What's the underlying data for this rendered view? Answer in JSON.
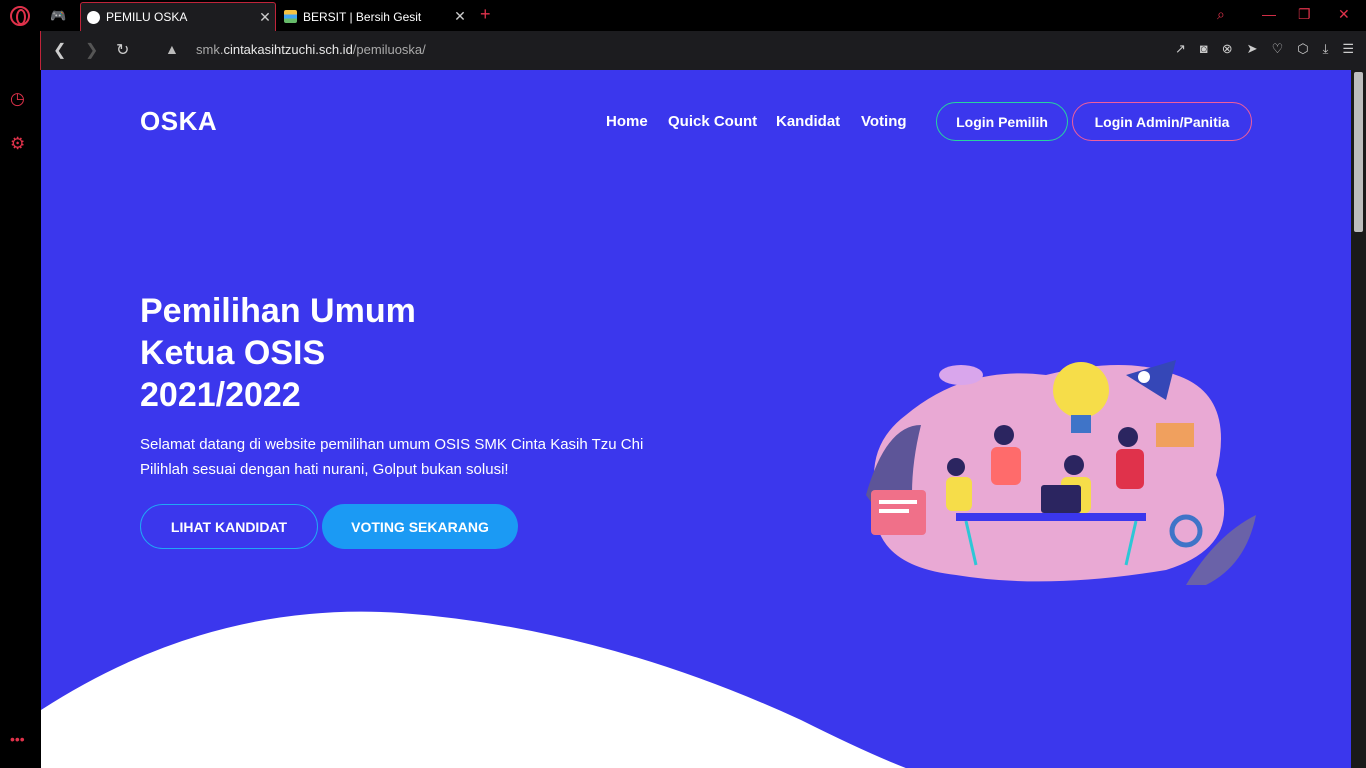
{
  "browser": {
    "tabs": [
      {
        "title": "PEMILU OSKA",
        "active": true
      },
      {
        "title": "BERSIT | Bersih Gesit",
        "active": false
      }
    ],
    "url_prefix": "smk.",
    "url_domain": "cintakasihtzuchi.sch.id",
    "url_path": "/pemiluoska/",
    "accent_color": "#e0324b"
  },
  "site": {
    "logo": "OSKA",
    "nav": [
      "Home",
      "Quick Count",
      "Kandidat",
      "Voting"
    ],
    "login_pemilih": "Login Pemilih",
    "login_admin": "Login Admin/Panitia",
    "hero": {
      "line1": "Pemilihan Umum",
      "line2": "Ketua OSIS",
      "line3": "2021/2022",
      "subtitle1": "Selamat datang di website pemilihan umum OSIS SMK Cinta Kasih Tzu Chi",
      "subtitle2": "Pilihlah sesuai dengan hati nurani, Golput bukan solusi!",
      "btn_lihat": "LIHAT KANDIDAT",
      "btn_voting": "VOTING SEKARANG"
    },
    "colors": {
      "background": "#3b37ed",
      "primary_button": "#1b9af4"
    }
  }
}
